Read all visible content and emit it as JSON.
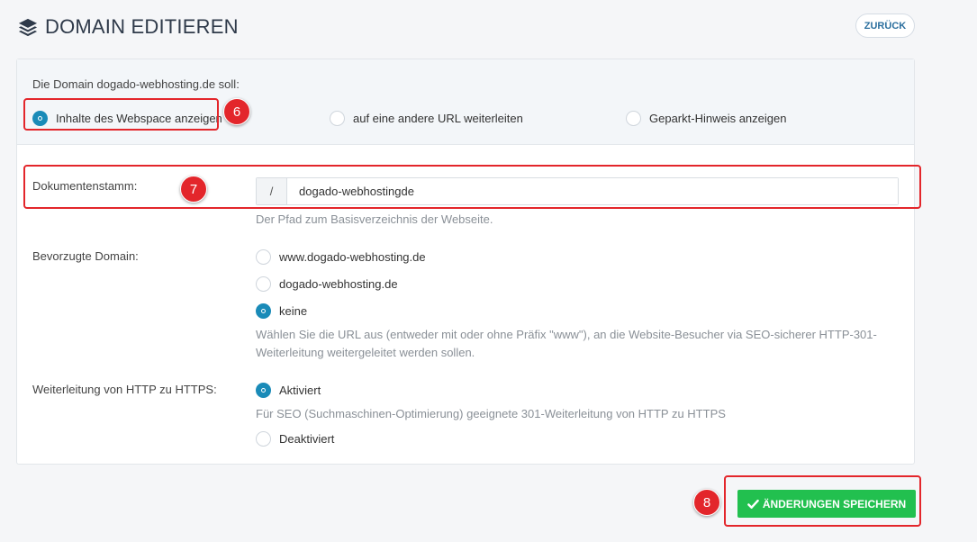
{
  "header": {
    "title": "DOMAIN EDITIEREN",
    "back_label": "ZURÜCK"
  },
  "mode": {
    "question": "Die Domain dogado-webhosting.de soll:",
    "options": [
      {
        "label": "Inhalte des Webspace anzeigen",
        "selected": true
      },
      {
        "label": "auf eine andere URL weiterleiten",
        "selected": false
      },
      {
        "label": "Geparkt-Hinweis anzeigen",
        "selected": false
      }
    ]
  },
  "docroot": {
    "label": "Dokumentenstamm:",
    "prefix": "/",
    "value": "dogado-webhostingde",
    "help": "Der Pfad zum Basisverzeichnis der Webseite."
  },
  "preferred_domain": {
    "label": "Bevorzugte Domain:",
    "options": [
      {
        "label": "www.dogado-webhosting.de",
        "selected": false
      },
      {
        "label": "dogado-webhosting.de",
        "selected": false
      },
      {
        "label": "keine",
        "selected": true
      }
    ],
    "help_line1": "Wählen Sie die URL aus (entweder mit oder ohne Präfix \"www\"), an die Website-Besucher via SEO-sicherer HTTP-301-",
    "help_line2": "Weiterleitung weitergeleitet werden sollen."
  },
  "https_redirect": {
    "label": "Weiterleitung von HTTP zu HTTPS:",
    "options": [
      {
        "label": "Aktiviert",
        "selected": true
      },
      {
        "label": "Deaktiviert",
        "selected": false
      }
    ],
    "help": "Für SEO (Suchmaschinen-Optimierung) geeignete 301-Weiterleitung von HTTP zu HTTPS"
  },
  "save_label": "ÄNDERUNGEN SPEICHERN",
  "annotations": [
    "6",
    "7",
    "8"
  ],
  "colors": {
    "accent": "#1a8bb8",
    "save": "#22c04f",
    "annotation": "#e3262b"
  }
}
